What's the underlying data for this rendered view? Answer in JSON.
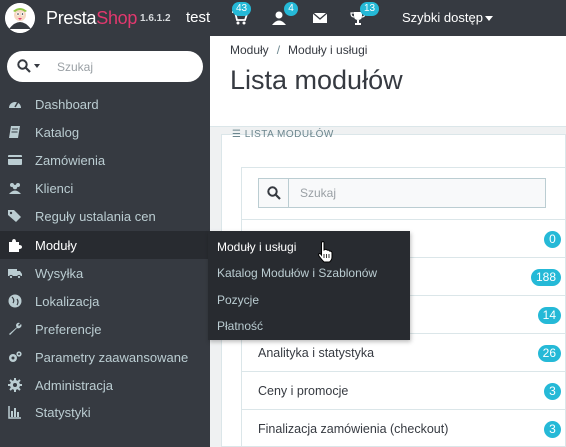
{
  "header": {
    "brand_presta": "Presta",
    "brand_shop": "Shop",
    "version": "1.6.1.2",
    "shop_name": "test",
    "badges": {
      "orders": "43",
      "customers": "4",
      "messages": "",
      "trophy": "13"
    },
    "quick_access": "Szybki dostęp",
    "icons": [
      "cart-icon",
      "user-icon",
      "envelope-icon",
      "trophy-icon"
    ],
    "accent_color": "#25b9d7",
    "brand_color": "#e2386e"
  },
  "sidebar": {
    "search_placeholder": "Szukaj",
    "items": [
      {
        "label": "Dashboard",
        "icon": "speedometer-icon"
      },
      {
        "label": "Katalog",
        "icon": "book-icon"
      },
      {
        "label": "Zamówienia",
        "icon": "credit-card-icon"
      },
      {
        "label": "Klienci",
        "icon": "users-icon"
      },
      {
        "label": "Reguły ustalania cen",
        "icon": "tags-icon"
      },
      {
        "label": "Moduły",
        "icon": "puzzle-icon"
      },
      {
        "label": "Wysyłka",
        "icon": "truck-icon"
      },
      {
        "label": "Lokalizacja",
        "icon": "globe-icon"
      },
      {
        "label": "Preferencje",
        "icon": "wrench-icon"
      },
      {
        "label": "Parametry zaawansowane",
        "icon": "cogs-icon"
      },
      {
        "label": "Administracja",
        "icon": "gear-icon"
      },
      {
        "label": "Statystyki",
        "icon": "bar-chart-icon"
      }
    ],
    "active_item": "Moduły"
  },
  "flyout": {
    "items": [
      "Moduły i usługi",
      "Katalog Modułów i Szablonów",
      "Pozycje",
      "Płatność"
    ]
  },
  "breadcrumb": {
    "first": "Moduły",
    "second": "Moduły i usługi",
    "separator": "/"
  },
  "page_title": "Lista modułów",
  "panel": {
    "heading": "LISTA MODUŁÓW",
    "search_placeholder": "Szukaj",
    "rows": [
      {
        "label": "",
        "count": "0"
      },
      {
        "label": "",
        "count": "188"
      },
      {
        "label": "",
        "count": "14"
      },
      {
        "label": "Analityka i statystyka",
        "count": "26"
      },
      {
        "label": "Ceny i promocje",
        "count": "3"
      },
      {
        "label": "Finalizacja zamówienia (checkout)",
        "count": "3"
      }
    ]
  }
}
